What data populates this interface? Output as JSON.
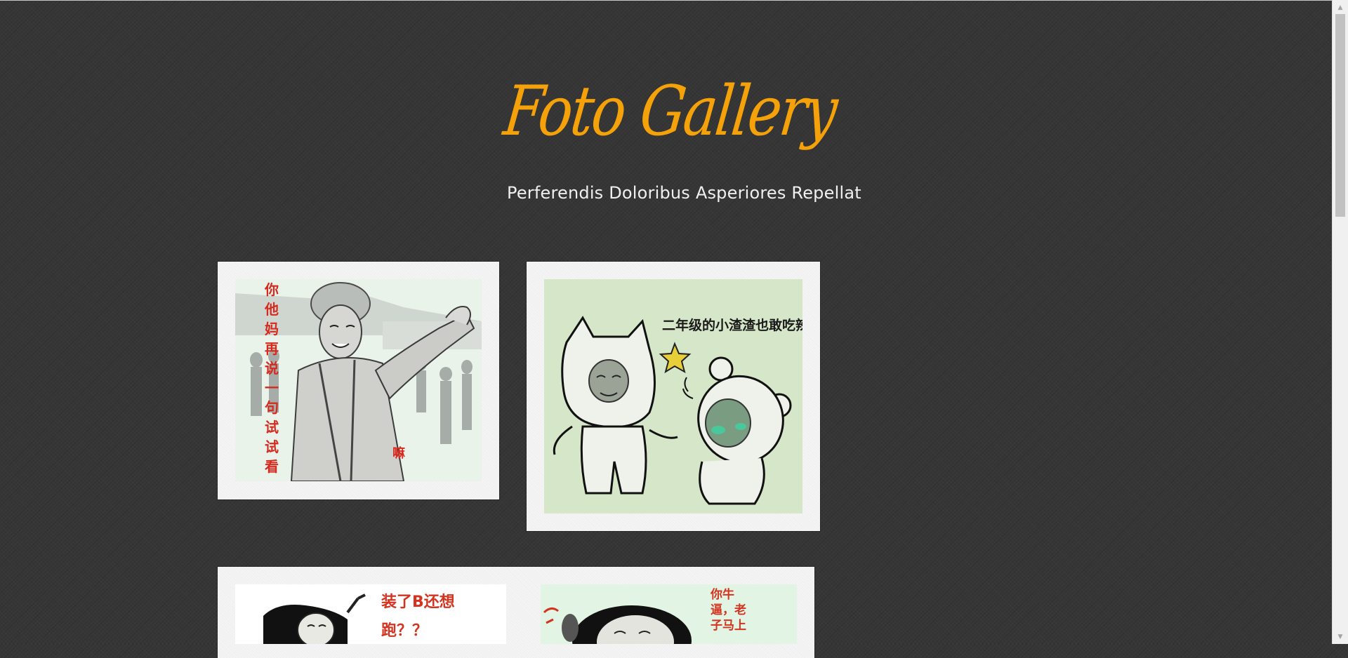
{
  "site": {
    "title": "Foto Gallery",
    "tagline": "Perferendis Doloribus Asperiores Repellat"
  },
  "photos": [
    {
      "caption": "你他妈再说一句试试看",
      "extra": "嘛"
    },
    {
      "caption": "二年级的小渣渣也敢吃辣条"
    },
    {
      "caption": "装了B还想跑？？"
    },
    {
      "caption": "你牛逼，老子马上"
    }
  ],
  "colors": {
    "title": "#f5a10a",
    "background": "#363636",
    "frame": "#f4f4f4"
  }
}
